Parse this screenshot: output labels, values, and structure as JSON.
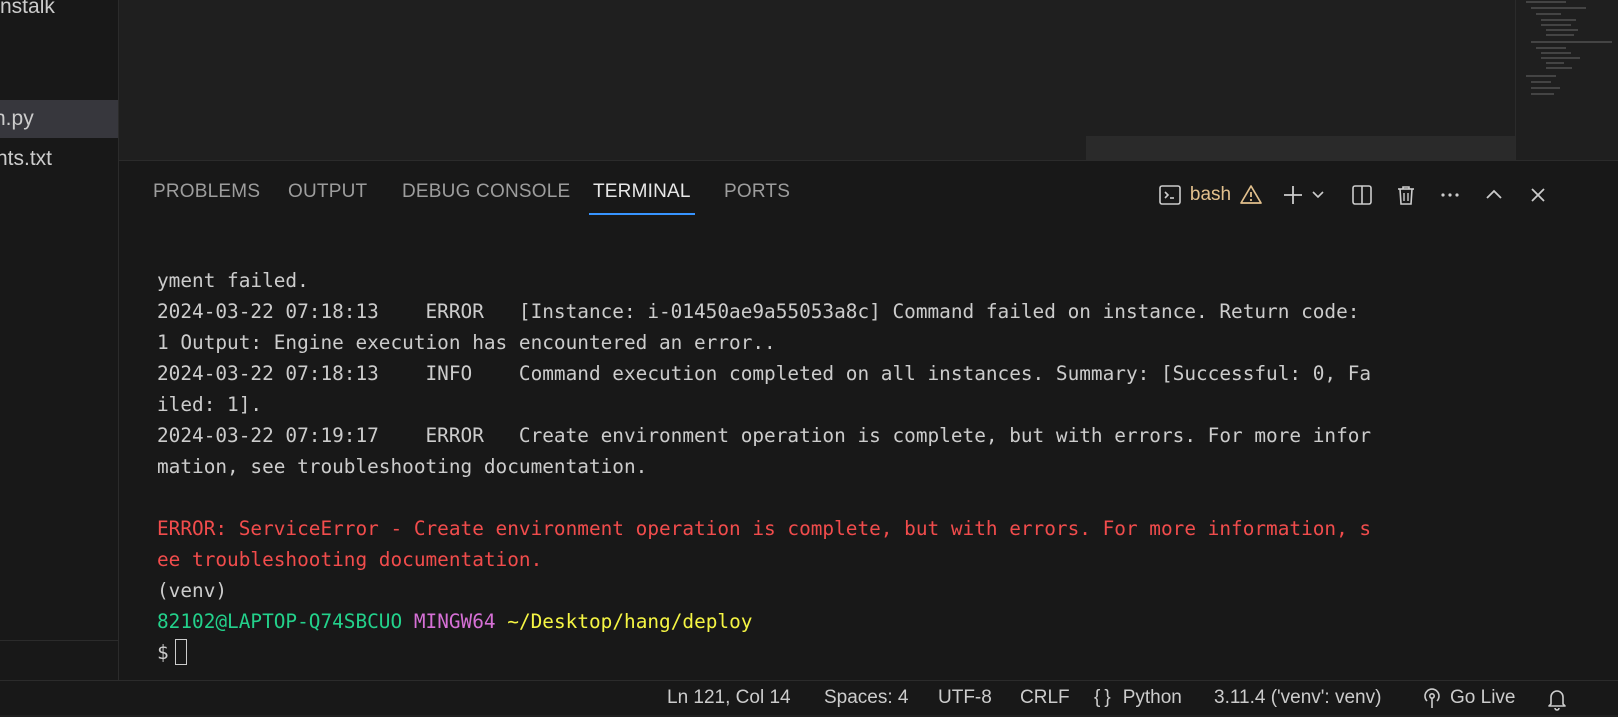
{
  "sidebar": {
    "items": [
      {
        "label": "nstalk"
      },
      {
        "label": "n.py"
      },
      {
        "label": "nts.txt"
      }
    ]
  },
  "panel": {
    "tabs": [
      {
        "label": "PROBLEMS"
      },
      {
        "label": "OUTPUT"
      },
      {
        "label": "DEBUG CONSOLE"
      },
      {
        "label": "TERMINAL"
      },
      {
        "label": "PORTS"
      }
    ],
    "active_tab": "TERMINAL",
    "terminal_name": "bash"
  },
  "terminal": {
    "lines": [
      "yment failed.",
      "2024-03-22 07:18:13    ERROR   [Instance: i-01450ae9a55053a8c] Command failed on instance. Return code:",
      "1 Output: Engine execution has encountered an error..",
      "2024-03-22 07:18:13    INFO    Command execution completed on all instances. Summary: [Successful: 0, Fa",
      "iled: 1].",
      "2024-03-22 07:19:17    ERROR   Create environment operation is complete, but with errors. For more infor",
      "mation, see troubleshooting documentation."
    ],
    "error_lines": [
      "ERROR: ServiceError - Create environment operation is complete, but with errors. For more information, s",
      "ee troubleshooting documentation."
    ],
    "venv": "(venv)",
    "prompt_user": "82102@LAPTOP-Q74SBCUO",
    "prompt_shell": "MINGW64",
    "prompt_path": "~/Desktop/hang/deploy",
    "prompt_symbol": "$"
  },
  "statusbar": {
    "position": "Ln 121, Col 14",
    "spaces": "Spaces: 4",
    "encoding": "UTF-8",
    "eol": "CRLF",
    "language_braces": "{}",
    "language": "Python",
    "interpreter": "3.11.4 ('venv': venv)",
    "golive": "Go Live"
  },
  "colors": {
    "accent": "#3794ff",
    "error": "#f14c4c",
    "warning": "#e2c08d",
    "prompt_green": "#23d18b",
    "prompt_magenta": "#d670d6",
    "prompt_yellow": "#f5f543"
  },
  "icons": [
    "terminal-icon",
    "warning-icon",
    "plus-icon",
    "chevron-down-icon",
    "split-icon",
    "trash-icon",
    "more-icon",
    "maximize-icon",
    "close-icon",
    "broadcast-icon",
    "bell-icon"
  ]
}
